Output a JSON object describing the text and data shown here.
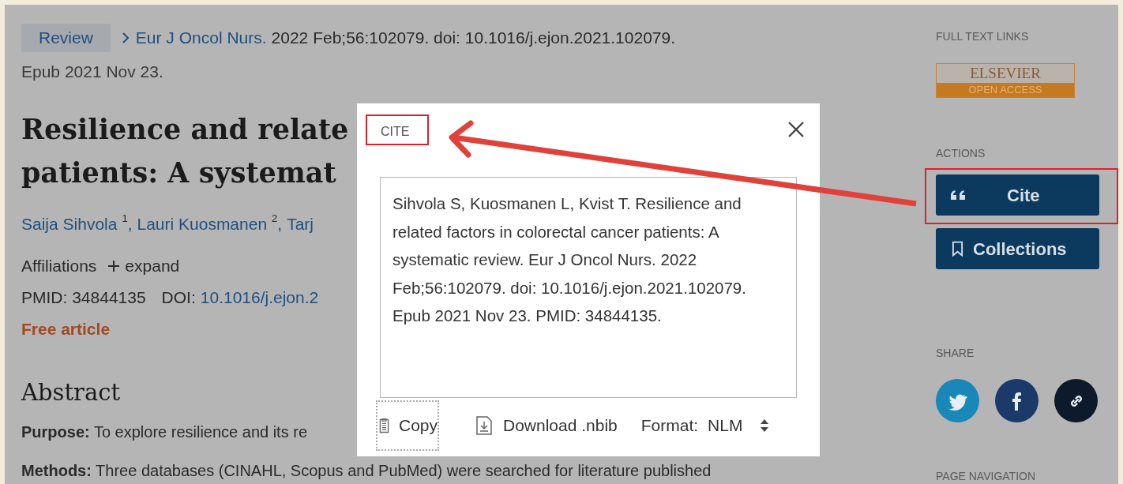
{
  "breadcrumb": {
    "tag": "Review",
    "journal": "Eur J Oncol Nurs.",
    "citation": "2022 Feb;56:102079. doi: 10.1016/j.ejon.2021.102079.",
    "epub": "Epub 2021 Nov 23."
  },
  "article": {
    "title_lines": [
      "Resilience and relate",
      "patients: A systemat"
    ],
    "authors": [
      {
        "name": "Saija Sihvola",
        "affiliation": "1",
        "separator": ","
      },
      {
        "name": "Lauri Kuosmanen",
        "affiliation": "2",
        "separator": ","
      },
      {
        "name": "Tarj"
      }
    ],
    "affiliations_label": "Affiliations",
    "expand_label": "expand",
    "pmid": "PMID: 34844135",
    "doi_label": "DOI:",
    "doi": "10.1016/j.ejon.2",
    "free": "Free article"
  },
  "abstract": {
    "heading": "Abstract",
    "paragraphs": [
      "**Purpose:** To explore resilience and its re",
      "**Methods:** Three databases (CINAHL, Scopus and PubMed) were searched for literature published"
    ]
  },
  "sidebar": {
    "full_text_heading": "FULL TEXT LINKS",
    "logo_top": "ELSEVIER",
    "logo_bottom": "OPEN ACCESS",
    "actions_heading": "ACTIONS",
    "actions": [
      {
        "kind": "cite",
        "label": "Cite"
      },
      {
        "kind": "collections",
        "label": "Collections"
      }
    ],
    "share_heading": "SHARE",
    "share": [
      {
        "kind": "twitter"
      },
      {
        "kind": "facebook"
      },
      {
        "kind": "link"
      }
    ],
    "page_navigation_heading": "PAGE NAVIGATION"
  },
  "cite_dialog": {
    "title": "CITE",
    "citation": "Sihvola S, Kuosmanen L, Kvist T. Resilience and related factors in colorectal cancer patients: A systematic review. Eur J Oncol Nurs. 2022 Feb;56:102079. doi: 10.1016/j.ejon.2021.102079. Epub 2021 Nov 23. PMID: 34844135.",
    "copy": "Copy",
    "download": "Download .nbib",
    "format_label": "Format:",
    "format_value": "NLM"
  }
}
